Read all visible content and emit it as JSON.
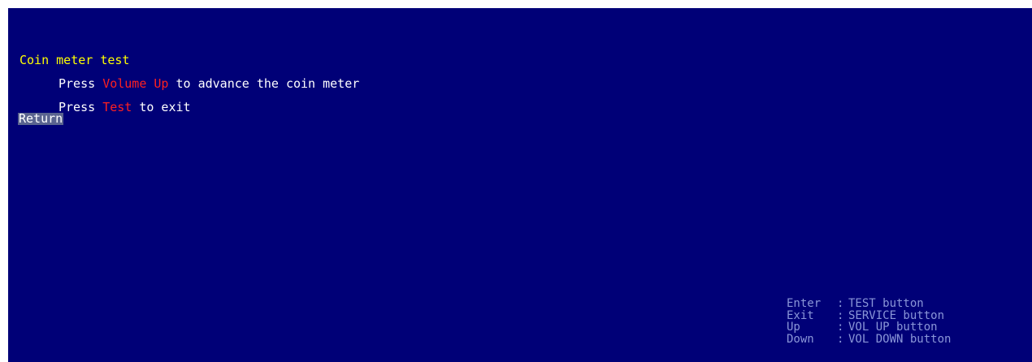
{
  "screen": {
    "title": "Coin meter test",
    "instruction_1": {
      "prefix": "Press ",
      "highlight": "Volume Up",
      "suffix": " to advance the coin meter"
    },
    "instruction_2": {
      "prefix": "Press ",
      "highlight": "Test",
      "suffix": " to exit"
    },
    "return_label": "Return"
  },
  "help": [
    {
      "key": "Enter",
      "sep": ":",
      "desc": "TEST button"
    },
    {
      "key": "Exit",
      "sep": ":",
      "desc": "SERVICE button"
    },
    {
      "key": "Up",
      "sep": ":",
      "desc": "VOL UP button"
    },
    {
      "key": "Down",
      "sep": ":",
      "desc": "VOL DOWN button"
    }
  ],
  "colors": {
    "background": "#000077",
    "title": "#ffff00",
    "highlight": "#ff2020",
    "text": "#ffffff",
    "help_text": "#8a96d8",
    "selection": "#5a6490"
  }
}
